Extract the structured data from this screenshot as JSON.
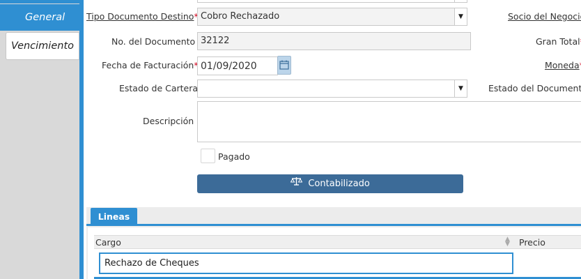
{
  "side_tabs": {
    "general": "General",
    "vencimiento": "Vencimiento"
  },
  "form": {
    "tipo_documento_label": "Tipo Documento Destino",
    "tipo_documento_value": "Cobro Rechazado",
    "socio_label": "Socio del Negocio",
    "no_documento_label": "No. del Documento",
    "no_documento_value": "32122",
    "gran_total_label": "Gran Total",
    "fecha_label": "Fecha de Facturación",
    "fecha_value": "01/09/2020",
    "moneda_label": "Moneda",
    "estado_cartera_label": "Estado de Cartera",
    "estado_cartera_value": "",
    "estado_documento_label": "Estado del Documento",
    "descripcion_label": "Descripción",
    "descripcion_value": "",
    "pagado_label": "Pagado",
    "pagado_checked": false,
    "required_mark": "*"
  },
  "actions": {
    "contabilizado_label": "Contabilizado"
  },
  "lines_panel": {
    "tab_label": "Lineas",
    "columns": [
      "Cargo",
      "Precio"
    ],
    "rows": [
      {
        "cargo": "Rechazo de Cheques",
        "precio": ""
      }
    ]
  },
  "icons": {
    "dropdown": "chevron-down-icon",
    "calendar": "calendar-icon",
    "sort": "sort-icon",
    "scale": "balance-scale-icon"
  },
  "colors": {
    "accent": "#2f8fd2",
    "button": "#3c6b98",
    "required": "#d0021b"
  }
}
